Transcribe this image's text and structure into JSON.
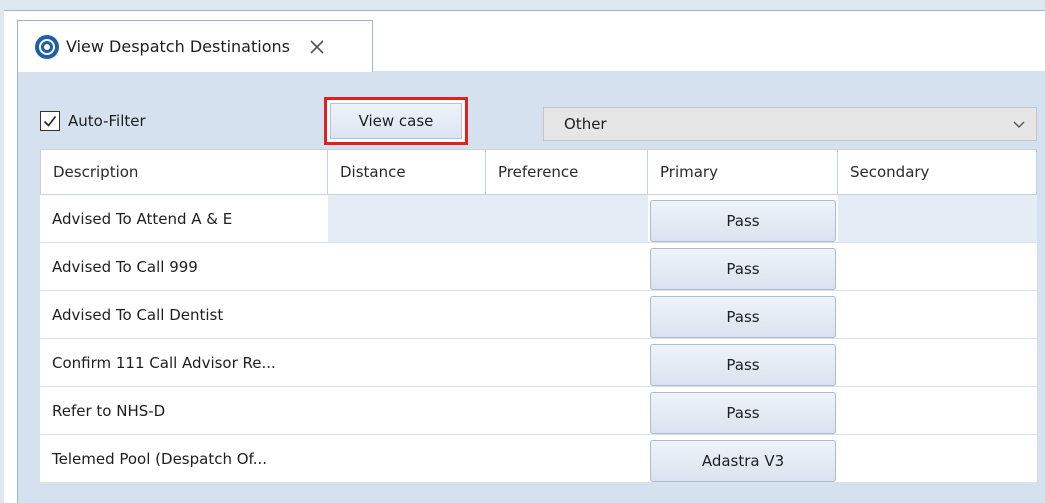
{
  "tab": {
    "title": "View Despatch Destinations",
    "icon": "despatch-target-icon",
    "close_icon": "close-icon"
  },
  "toolbar": {
    "auto_filter_label": "Auto-Filter",
    "auto_filter_checked": true,
    "view_case_label": "View case",
    "filter_select_value": "Other"
  },
  "grid": {
    "columns": [
      "Description",
      "Distance",
      "Preference",
      "Primary",
      "Secondary"
    ],
    "rows": [
      {
        "description": "Advised To Attend A & E",
        "primary": "Pass",
        "selected": true
      },
      {
        "description": "Advised To Call 999",
        "primary": "Pass"
      },
      {
        "description": "Advised To Call Dentist",
        "primary": "Pass"
      },
      {
        "description": "Confirm 111 Call Advisor Re...",
        "primary": "Pass"
      },
      {
        "description": "Refer to NHS-D",
        "primary": "Pass"
      },
      {
        "description": "Telemed Pool (Despatch Of...",
        "primary": "Adastra V3"
      }
    ]
  },
  "colors": {
    "highlight": "#e0201c",
    "panel": "#d6e1ef",
    "selected_row": "#e4ecf6",
    "icon_blue": "#1f5fa8"
  }
}
